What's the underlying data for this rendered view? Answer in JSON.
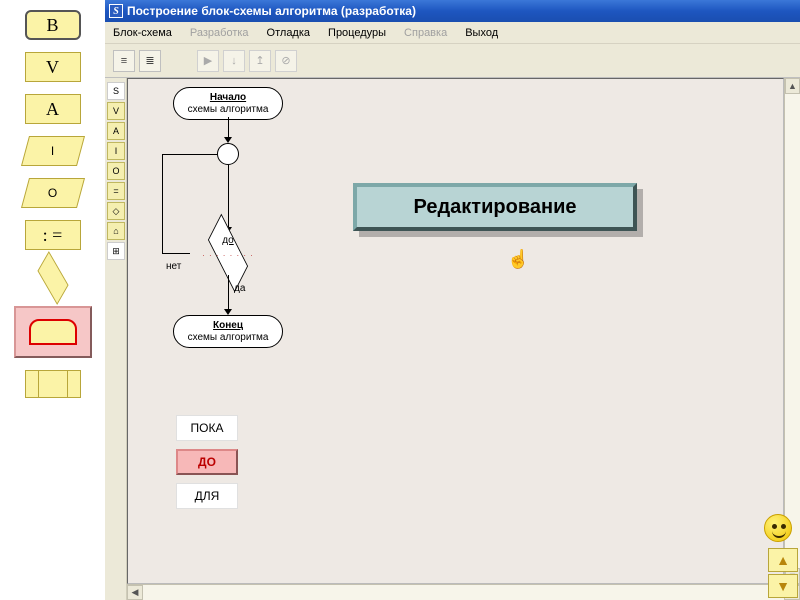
{
  "palette": {
    "items": [
      {
        "label": "B"
      },
      {
        "label": "V"
      },
      {
        "label": "A"
      },
      {
        "label": "I"
      },
      {
        "label": "O"
      },
      {
        "label": ": ="
      }
    ]
  },
  "window": {
    "title": "Построение блок-схемы алгоритма (разработка)"
  },
  "menu": {
    "items": [
      {
        "label": "Блок-схема",
        "enabled": true
      },
      {
        "label": "Разработка",
        "enabled": false
      },
      {
        "label": "Отладка",
        "enabled": true
      },
      {
        "label": "Процедуры",
        "enabled": true
      },
      {
        "label": "Справка",
        "enabled": false
      },
      {
        "label": "Выход",
        "enabled": true
      }
    ]
  },
  "flowchart": {
    "start": {
      "line1": "Начало",
      "line2": "схемы алгоритма"
    },
    "end": {
      "line1": "Конец",
      "line2": "схемы алгоритма"
    },
    "cond": {
      "label": "до",
      "dots": "· · · · · · · ·"
    },
    "no": "нет",
    "yes": "да"
  },
  "callout": {
    "text": "Редактирование"
  },
  "loop_labels": {
    "items": [
      "ПОКА",
      "ДО",
      "ДЛЯ"
    ],
    "selected_index": 1
  },
  "side_tools": [
    "S",
    "V",
    "A",
    "I",
    "O",
    "=",
    "◇",
    "⌂",
    "⊞"
  ]
}
